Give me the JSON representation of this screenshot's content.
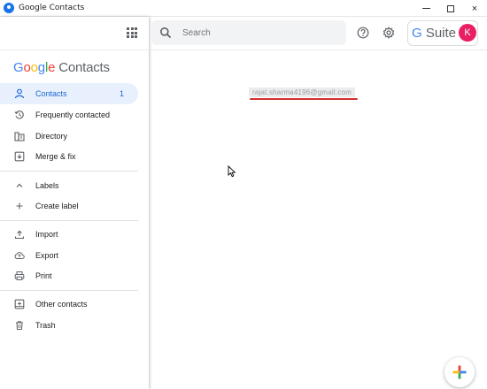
{
  "window": {
    "title": "Google Contacts",
    "controls": {
      "minimize": "minimize",
      "maximize": "maximize",
      "close": "×"
    }
  },
  "brand": {
    "logo_letters": [
      "G",
      "o",
      "o",
      "g",
      "l",
      "e"
    ],
    "product": "Contacts",
    "colors": {
      "blue": "#4285f4",
      "red": "#ea4335",
      "yellow": "#fbbc05",
      "green": "#34a853"
    }
  },
  "sidebar": {
    "primary": [
      {
        "label": "Contacts",
        "count": "1",
        "icon": "person-icon",
        "active": true
      },
      {
        "label": "Frequently contacted",
        "icon": "history-icon"
      },
      {
        "label": "Directory",
        "icon": "directory-icon"
      },
      {
        "label": "Merge & fix",
        "icon": "merge-icon"
      }
    ],
    "labels_section": [
      {
        "label": "Labels",
        "icon": "chevron-up-icon"
      },
      {
        "label": "Create label",
        "icon": "plus-icon"
      }
    ],
    "tools": [
      {
        "label": "Import",
        "icon": "upload-icon"
      },
      {
        "label": "Export",
        "icon": "cloud-upload-icon"
      },
      {
        "label": "Print",
        "icon": "printer-icon"
      }
    ],
    "other": [
      {
        "label": "Other contacts",
        "icon": "contact-add-icon"
      },
      {
        "label": "Trash",
        "icon": "trash-icon"
      }
    ],
    "active_color": "#1967d2",
    "active_bg": "#e8f0fe"
  },
  "header": {
    "search_placeholder": "Search",
    "gsuite_g": "G",
    "gsuite_text": " Suite",
    "avatar_letter": "K",
    "avatar_color": "#e91e63"
  },
  "main": {
    "email": "rajat.sharma4196@gmail.com",
    "underline_color": "#d32f2f"
  },
  "fab": {
    "icon": "add-icon"
  }
}
